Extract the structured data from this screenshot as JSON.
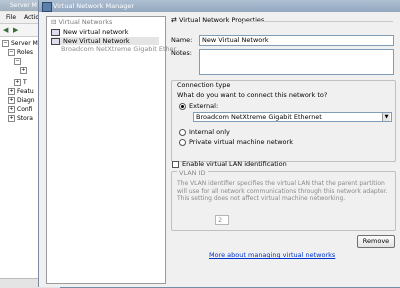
{
  "bg_window": {
    "title": "Server M",
    "menu": [
      "File",
      "Actio"
    ],
    "tree": [
      "Server M",
      "Roles",
      "",
      "T",
      "Featu",
      "Diagn",
      "Confi",
      "Stora"
    ]
  },
  "dialog": {
    "title": "Virtual Network Manager",
    "left_list": {
      "header": "Virtual Networks",
      "items": [
        "New virtual network",
        "New Virtual Network",
        "Broadcom NetXtreme Gigabit Ether..."
      ]
    },
    "section_title": "Virtual Network Properties",
    "name_label": "Name:",
    "name_value": "New Virtual Network",
    "notes_label": "Notes:",
    "notes_value": "",
    "connection_type": {
      "title": "Connection type",
      "question": "What do you want to connect this network to?",
      "external_label": "External:",
      "adapter_selected": "Broadcom NetXtreme Gigabit Ethernet",
      "internal_label": "Internal only",
      "private_label": "Private virtual machine network",
      "selected": "external"
    },
    "vlan": {
      "checkbox_label": "Enable virtual LAN identification",
      "checked": false,
      "group_title": "VLAN ID",
      "description": "The VLAN identifier specifies the virtual LAN that the parent partition will use for all network communications through this network adapter. This setting does not affect virtual machine networking.",
      "spinner_value": "2"
    },
    "remove_button": "Remove",
    "more_link": "More about managing virtual networks"
  }
}
